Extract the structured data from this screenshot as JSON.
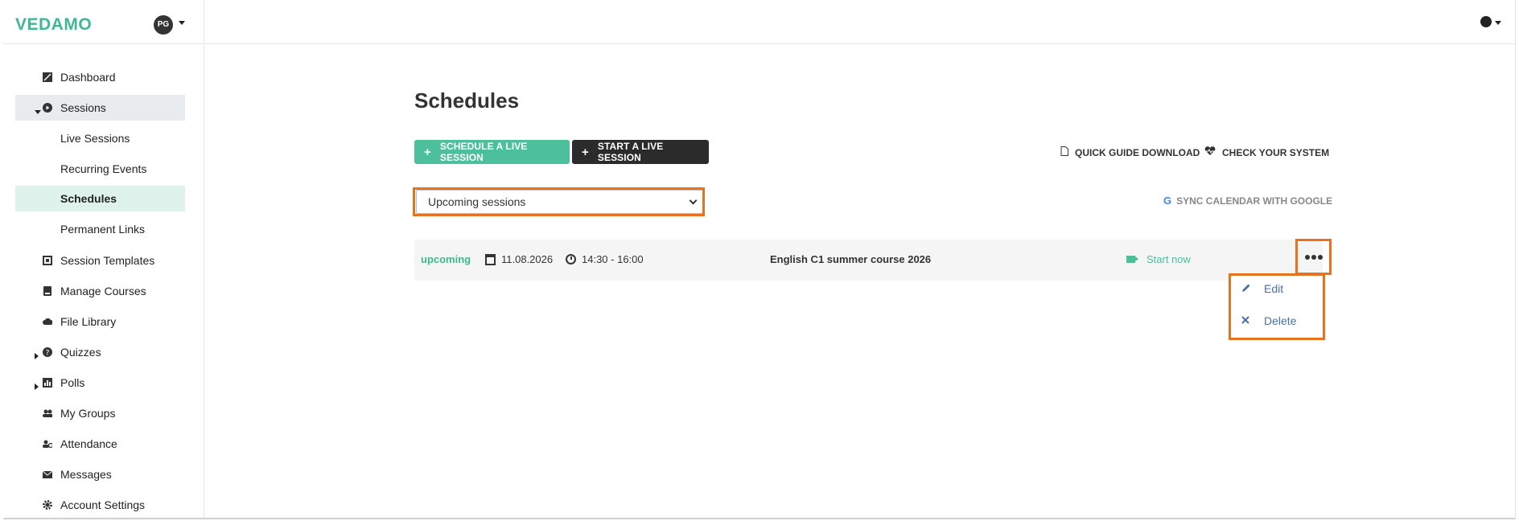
{
  "app": {
    "logo": "VEDAMO",
    "avatar_initials": "PG"
  },
  "sidebar": {
    "items": [
      {
        "label": "Dashboard",
        "icon": "dashboard-icon"
      },
      {
        "label": "Sessions",
        "icon": "play-circle-icon"
      },
      {
        "label": "Live Sessions"
      },
      {
        "label": "Recurring Events"
      },
      {
        "label": "Schedules"
      },
      {
        "label": "Permanent Links"
      },
      {
        "label": "Session Templates",
        "icon": "template-icon"
      },
      {
        "label": "Manage Courses",
        "icon": "book-icon"
      },
      {
        "label": "File Library",
        "icon": "cloud-icon"
      },
      {
        "label": "Quizzes",
        "icon": "question-icon"
      },
      {
        "label": "Polls",
        "icon": "chart-icon"
      },
      {
        "label": "My Groups",
        "icon": "users-icon"
      },
      {
        "label": "Attendance",
        "icon": "attendance-icon"
      },
      {
        "label": "Messages",
        "icon": "envelope-icon"
      },
      {
        "label": "Account Settings",
        "icon": "gear-icon"
      }
    ]
  },
  "main": {
    "title": "Schedules",
    "schedule_button": "SCHEDULE A LIVE SESSION",
    "start_button": "START A LIVE SESSION",
    "quick_guide": "QUICK GUIDE DOWNLOAD",
    "check_system": "CHECK YOUR SYSTEM",
    "filter_value": "Upcoming sessions",
    "sync_calendar": "SYNC CALENDAR WITH GOOGLE",
    "sessions": [
      {
        "status": "upcoming",
        "date": "11.08.2026",
        "time": "14:30 - 16:00",
        "title": "English C1 summer course 2026",
        "action": "Start now"
      }
    ],
    "menu": {
      "edit": "Edit",
      "delete": "Delete"
    }
  },
  "colors": {
    "accent": "#4dbf9b",
    "highlight": "#e8731f",
    "dark_button": "#2b2b2b",
    "link": "#4a6fa5"
  }
}
